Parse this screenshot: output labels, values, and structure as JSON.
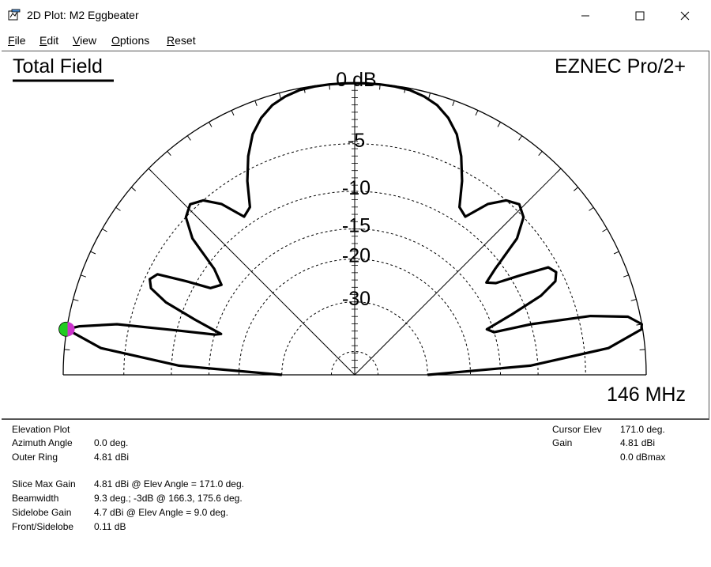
{
  "window": {
    "title": "2D Plot: M2 Eggbeater",
    "icon": "plot-window-icon",
    "controls": [
      "minimize-icon",
      "maximize-icon",
      "close-icon"
    ]
  },
  "menu": [
    "File",
    "Edit",
    "View",
    "Options",
    "Reset"
  ],
  "plot": {
    "heading": "Total Field",
    "brand": "EZNEC Pro/2+",
    "frequency": "146 MHz",
    "ring_labels": [
      "0 dB",
      "-5",
      "-10",
      "-15",
      "-20",
      "-30"
    ],
    "cursor_marker_colors": [
      "#22cc22",
      "#cc33cc"
    ]
  },
  "chart_data": {
    "type": "polar-elevation",
    "title": "Total Field",
    "ring_labels_db": [
      0,
      -5,
      -10,
      -15,
      -20,
      -30
    ],
    "elevation_deg": [
      0,
      3,
      6,
      9,
      10,
      12,
      14,
      16,
      17,
      19,
      21,
      23,
      25,
      27,
      29,
      31,
      33,
      35,
      37,
      40,
      43,
      46,
      49,
      52,
      55,
      58,
      61,
      64,
      67,
      70,
      73,
      76,
      79,
      82,
      85,
      88,
      90,
      92,
      95,
      98,
      101,
      104,
      107,
      110,
      113,
      116,
      119,
      122,
      125,
      128,
      131,
      134,
      137,
      140,
      143,
      146,
      149,
      151,
      153,
      155,
      157,
      159,
      161,
      163,
      164,
      166,
      168,
      170,
      171,
      174,
      177,
      180
    ],
    "gain_dbmax": [
      -30,
      -11,
      -3,
      -0.1,
      0,
      -1,
      -4,
      -10,
      -15,
      -16,
      -12,
      -8,
      -6,
      -5.5,
      -6,
      -9,
      -12,
      -13,
      -11,
      -7,
      -5,
      -4.5,
      -5,
      -6.5,
      -9,
      -8.5,
      -6,
      -4,
      -2.5,
      -1.5,
      -0.8,
      -0.4,
      -0.15,
      -0.05,
      -0.02,
      -0.01,
      -0.01,
      -0.01,
      -0.02,
      -0.05,
      -0.15,
      -0.4,
      -0.8,
      -1.5,
      -2.5,
      -4,
      -6,
      -8.5,
      -9,
      -6.5,
      -5,
      -4.5,
      -5,
      -7,
      -11,
      -13,
      -12,
      -9,
      -6,
      -5.5,
      -6,
      -8,
      -12,
      -16,
      -15,
      -10,
      -4,
      -1,
      0,
      -3,
      -11,
      -30
    ],
    "cursor_elevation_deg": 171.0
  },
  "info": {
    "left_labels": [
      "Elevation Plot",
      "Azimuth Angle",
      "Outer Ring",
      "Slice Max Gain",
      "Beamwidth",
      "Sidelobe Gain",
      "Front/Sidelobe"
    ],
    "left_values": [
      "",
      "0.0 deg.",
      "4.81 dBi",
      "4.81 dBi @ Elev Angle = 171.0 deg.",
      "9.3 deg.; -3dB @ 166.3, 175.6 deg.",
      "4.7 dBi @ Elev Angle = 9.0 deg.",
      "0.11 dB"
    ],
    "right_labels": [
      "Cursor Elev",
      "Gain",
      ""
    ],
    "right_values": [
      "171.0 deg.",
      "4.81 dBi",
      "0.0 dBmax"
    ]
  }
}
